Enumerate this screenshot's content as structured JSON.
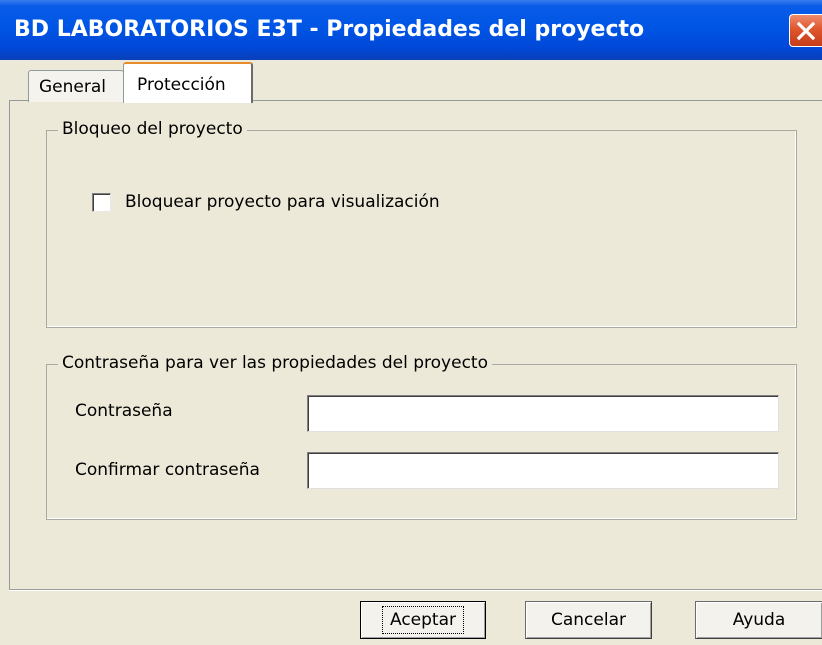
{
  "window": {
    "title": "BD LABORATORIOS E3T - Propiedades del proyecto",
    "close_icon": "close-icon"
  },
  "tabs": [
    {
      "label": "General",
      "selected": false
    },
    {
      "label": "Protección",
      "selected": true
    }
  ],
  "lock_group": {
    "legend": "Bloqueo del proyecto",
    "checkbox_label": "Bloquear proyecto para visualización",
    "checked": false
  },
  "password_group": {
    "legend": "Contraseña para ver las propiedades del proyecto",
    "password_label": "Contraseña",
    "password_value": "",
    "confirm_label": "Confirmar contraseña",
    "confirm_value": ""
  },
  "buttons": {
    "ok": "Aceptar",
    "cancel": "Cancelar",
    "help": "Ayuda"
  },
  "colors": {
    "titlebar": "#0055e5",
    "dialog_bg": "#ece9d8",
    "active_tab_highlight": "#e68b2c",
    "close_button": "#e0562e"
  }
}
